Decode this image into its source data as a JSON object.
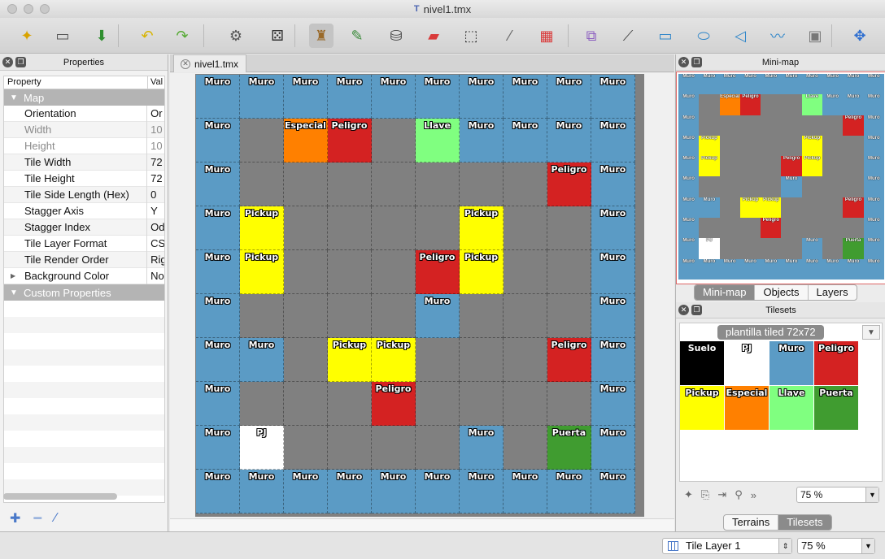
{
  "window": {
    "title": "nivel1.tmx"
  },
  "toolbar": {
    "tools": [
      {
        "name": "new-map-icon",
        "glyph": "✦",
        "color": "#d9a300"
      },
      {
        "name": "open-map-icon",
        "glyph": "▭",
        "color": "#555"
      },
      {
        "name": "save-map-icon",
        "glyph": "⬇",
        "color": "#2f8f2f"
      },
      {
        "name": "undo-icon",
        "glyph": "↶",
        "color": "#d8b400"
      },
      {
        "name": "redo-icon",
        "glyph": "↷",
        "color": "#55aa33"
      },
      {
        "name": "commands-icon",
        "glyph": "⚙",
        "color": "#555"
      },
      {
        "name": "random-mode-icon",
        "glyph": "⚄",
        "color": "#333"
      },
      {
        "name": "stamp-brush-icon",
        "glyph": "♜",
        "color": "#9a6a2a"
      },
      {
        "name": "terrain-brush-icon",
        "glyph": "✎",
        "color": "#3a8a3a"
      },
      {
        "name": "bucket-fill-icon",
        "glyph": "⛁",
        "color": "#444"
      },
      {
        "name": "eraser-icon",
        "glyph": "▰",
        "color": "#d93a3a"
      },
      {
        "name": "rectangle-select-icon",
        "glyph": "⬚",
        "color": "#333"
      },
      {
        "name": "magic-wand-icon",
        "glyph": "⁄",
        "color": "#666"
      },
      {
        "name": "select-same-tile-icon",
        "glyph": "▦",
        "color": "#d93a3a"
      },
      {
        "name": "select-objects-icon",
        "glyph": "⧉",
        "color": "#8c5fc0"
      },
      {
        "name": "edit-polygons-icon",
        "glyph": "⟋",
        "color": "#444"
      },
      {
        "name": "insert-rectangle-icon",
        "glyph": "▭",
        "color": "#2f86c9"
      },
      {
        "name": "insert-ellipse-icon",
        "glyph": "⬭",
        "color": "#2f86c9"
      },
      {
        "name": "insert-polygon-icon",
        "glyph": "◁",
        "color": "#2f86c9"
      },
      {
        "name": "insert-polyline-icon",
        "glyph": "〰",
        "color": "#2f86c9"
      },
      {
        "name": "insert-tile-icon",
        "glyph": "▣",
        "color": "#777"
      },
      {
        "name": "move-icon",
        "glyph": "✥",
        "color": "#2f6fd0"
      }
    ]
  },
  "properties_panel": {
    "title": "Properties",
    "col_property": "Property",
    "col_value": "Val",
    "group_map": "Map",
    "rows": [
      {
        "k": "Orientation",
        "v": "Or"
      },
      {
        "k": "Width",
        "v": "10",
        "dim": true
      },
      {
        "k": "Height",
        "v": "10",
        "dim": true
      },
      {
        "k": "Tile Width",
        "v": "72"
      },
      {
        "k": "Tile Height",
        "v": "72"
      },
      {
        "k": "Tile Side Length (Hex)",
        "v": "0"
      },
      {
        "k": "Stagger Axis",
        "v": "Y"
      },
      {
        "k": "Stagger Index",
        "v": "Od"
      },
      {
        "k": "Tile Layer Format",
        "v": "CS"
      },
      {
        "k": "Tile Render Order",
        "v": "Rig"
      },
      {
        "k": "Background Color",
        "v": "No",
        "collapsed": true
      }
    ],
    "group_custom": "Custom Properties"
  },
  "map_tab": {
    "label": "nivel1.tmx"
  },
  "tile_types": {
    "Muro": "#5b9bc5",
    "Especial": "#ff8000",
    "Peligro": "#d42222",
    "Llave": "#80ff80",
    "Pickup": "#ffff00",
    "PJ": "#ffffff",
    "Puerta": "#409c30",
    "Suelo": "#000000",
    "": "#808080"
  },
  "map_grid": [
    [
      "Muro",
      "Muro",
      "Muro",
      "Muro",
      "Muro",
      "Muro",
      "Muro",
      "Muro",
      "Muro",
      "Muro"
    ],
    [
      "Muro",
      "",
      "Especial",
      "Peligro",
      "",
      "Llave",
      "Muro",
      "Muro",
      "Muro",
      "Muro"
    ],
    [
      "Muro",
      "",
      "",
      "",
      "",
      "",
      "",
      "",
      "Peligro",
      "Muro"
    ],
    [
      "Muro",
      "Pickup",
      "",
      "",
      "",
      "",
      "Pickup",
      "",
      "",
      "Muro"
    ],
    [
      "Muro",
      "Pickup",
      "",
      "",
      "",
      "Peligro",
      "Pickup",
      "",
      "",
      "Muro"
    ],
    [
      "Muro",
      "",
      "",
      "",
      "",
      "Muro",
      "",
      "",
      "",
      "Muro"
    ],
    [
      "Muro",
      "Muro",
      "",
      "Pickup",
      "Pickup",
      "",
      "",
      "",
      "Peligro",
      "Muro"
    ],
    [
      "Muro",
      "",
      "",
      "",
      "Peligro",
      "",
      "",
      "",
      "",
      "Muro"
    ],
    [
      "Muro",
      "PJ",
      "",
      "",
      "",
      "",
      "Muro",
      "",
      "Puerta",
      "Muro"
    ],
    [
      "Muro",
      "Muro",
      "Muro",
      "Muro",
      "Muro",
      "Muro",
      "Muro",
      "Muro",
      "Muro",
      "Muro"
    ]
  ],
  "minimap_panel": {
    "title": "Mini-map",
    "tabs": [
      "Mini-map",
      "Objects",
      "Layers"
    ],
    "grid": [
      [
        "Muro",
        "Muro",
        "Muro",
        "Muro",
        "Muro",
        "Muro",
        "Muro",
        "Muro",
        "Muro",
        "Muro"
      ],
      [
        "Muro",
        "",
        "Especial",
        "Peligro",
        "",
        "",
        "Llave",
        "Muro",
        "Muro",
        "Muro"
      ],
      [
        "Muro",
        "",
        "",
        "",
        "",
        "",
        "",
        "",
        "Peligro",
        "Muro"
      ],
      [
        "Muro",
        "Pickup",
        "",
        "",
        "",
        "",
        "Pickup",
        "",
        "",
        "Muro"
      ],
      [
        "Muro",
        "Pickup",
        "",
        "",
        "",
        "Peligro",
        "Pickup",
        "",
        "",
        "Muro"
      ],
      [
        "Muro",
        "",
        "",
        "",
        "",
        "Muro",
        "",
        "",
        "",
        "Muro"
      ],
      [
        "Muro",
        "Muro",
        "",
        "Pickup",
        "Pickup",
        "",
        "",
        "",
        "Peligro",
        "Muro"
      ],
      [
        "Muro",
        "",
        "",
        "",
        "Peligro",
        "",
        "",
        "",
        "",
        "Muro"
      ],
      [
        "Muro",
        "PJ",
        "",
        "",
        "",
        "",
        "Muro",
        "",
        "Puerta",
        "Muro"
      ],
      [
        "Muro",
        "Muro",
        "Muro",
        "Muro",
        "Muro",
        "Muro",
        "Muro",
        "Muro",
        "Muro",
        "Muro"
      ]
    ]
  },
  "tilesets_panel": {
    "title": "Tilesets",
    "tileset_name": "plantilla tiled 72x72",
    "tiles": [
      "Suelo",
      "PJ",
      "Muro",
      "Peligro",
      "Pickup",
      "Especial",
      "Llave",
      "Puerta"
    ],
    "zoom": "75 %",
    "tabs": [
      "Terrains",
      "Tilesets"
    ]
  },
  "statusbar": {
    "layer": "Tile Layer 1",
    "zoom": "75 %"
  }
}
